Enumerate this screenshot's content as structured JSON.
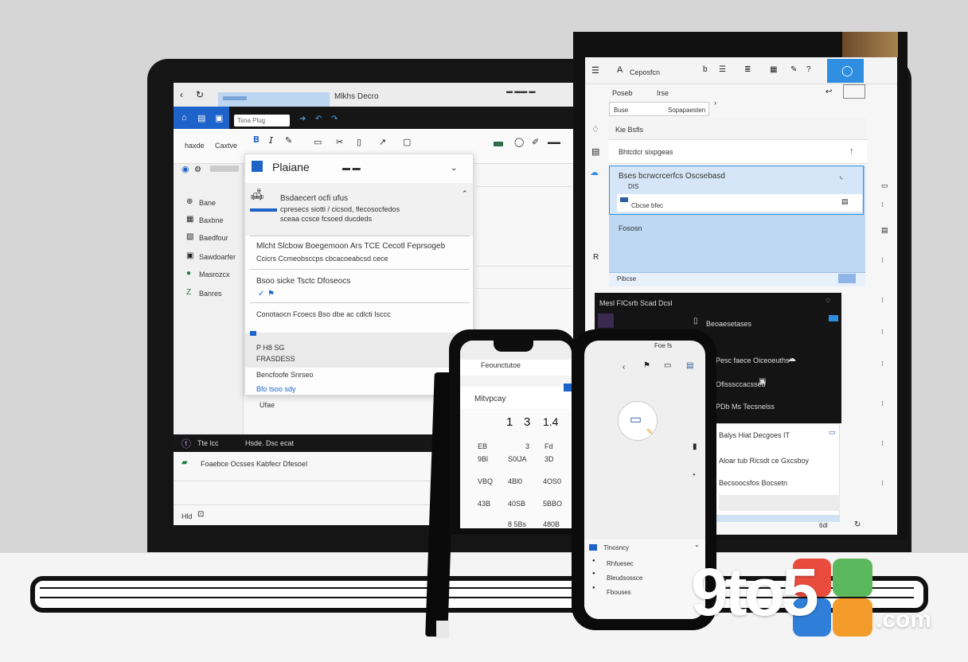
{
  "logo": {
    "text": "9to5",
    "suffix": ".com"
  },
  "colors": {
    "accent_blue": "#1d63c9",
    "selection_blue": "#cfe2f7",
    "dark_bar": "#161616",
    "logo_red": "#e94b3c",
    "logo_orange": "#f39c2c",
    "logo_green": "#5cb85c",
    "logo_blue": "#2f7ed8"
  },
  "laptop": {
    "titlebar": {
      "tab": "Mlkhs Decro"
    },
    "ribbon": {
      "search_placeholder": "Tsna Plug"
    },
    "left_tabs": [
      "haxde",
      "Caxtve"
    ],
    "sidebar": [
      "Bane",
      "Baxbne",
      "Baedfour",
      "Sawdoarfer",
      "Masrozcx",
      "Banres"
    ],
    "dialog": {
      "title": "Plaiane",
      "items": [
        {
          "line1": "Bsdaecert ocfi ufus",
          "line2": "cpresecs siotti / cicsod, flecosocfedos",
          "line3": "sceaa ccsce fcsoed ducdeds"
        },
        {
          "line1": "Mlcht Slcbow Boegemoon Ars TCE Cecotl Feprsogeb",
          "line2": "Ccicrs Ccmeobsccps cbcacoeabcsd cece"
        },
        {
          "line1": "Bsoo sicke Tsctc Dfoseocs",
          "line2": ""
        },
        {
          "line1": "Conotaocn Fcoecs Bso dbe ac cdlcti Isccc"
        }
      ],
      "footer": {
        "l1": "P H8 SG",
        "l2": "FRASDESS",
        "l3": "Bencfoofe Snrseo",
        "link": "Bfo tsoo sdy"
      },
      "bottom_label": "Ufae"
    },
    "statusbar": {
      "text": "Tte lcc",
      "label": "Hsde. Dsc ecat"
    },
    "bottom_row": "Foaebce Ocsses  Kabfecr Dfesoel",
    "footer_left": "Hld"
  },
  "tablet": {
    "toolbar": {
      "title": "Ceposfcn"
    },
    "tabs": [
      "Poseb",
      "Irse"
    ],
    "subtabs": [
      "Buse",
      "Sopapaesten"
    ],
    "rows": [
      {
        "label": "Kie Bsfls"
      },
      {
        "label": "Bhtcdcr sixpgeas"
      },
      {
        "label": "Bses bcrwcrcerfcs Oscsebasd",
        "sub": "DIS"
      },
      {
        "label": "Cbcse bfec"
      },
      {
        "label": "Fososn"
      }
    ],
    "footer_chip": "Pibcse",
    "dark_panel": {
      "title": "Mesl  FICsrb Scad Dcsl",
      "rows": [
        "Beoaesetases",
        "Pesc faece Oiceoeuths",
        "Ofisssccacssed",
        "PDb Ms Tecsnelss"
      ]
    },
    "light_panel": {
      "rows": [
        "Balys Hiat Decgoes IT",
        "Aloar tub Ricsdt ce Gxcsboy",
        "Becsoocsfos Bocsetn"
      ]
    },
    "bottom": "6dl"
  },
  "phone1": {
    "title": "Feounctutoe",
    "label": "Mitvpcay",
    "numbers": [
      [
        "1",
        "3",
        "1.4"
      ],
      [
        "EB",
        "3",
        "Fd"
      ],
      [
        "9Bl",
        "S0lJA",
        "3D"
      ],
      [
        "VBQ",
        "4Bl0",
        "4OS0"
      ],
      [
        "43B",
        "40SB",
        "5BBO"
      ],
      [
        "",
        "8 5Bs",
        "480B"
      ]
    ]
  },
  "phone2": {
    "status": "Foe fs",
    "menu": [
      {
        "label": "Tlnosncy"
      },
      {
        "label": "Rhfuesec"
      },
      {
        "label": "Bleudsossce"
      },
      {
        "label": "Fbouses"
      }
    ]
  }
}
